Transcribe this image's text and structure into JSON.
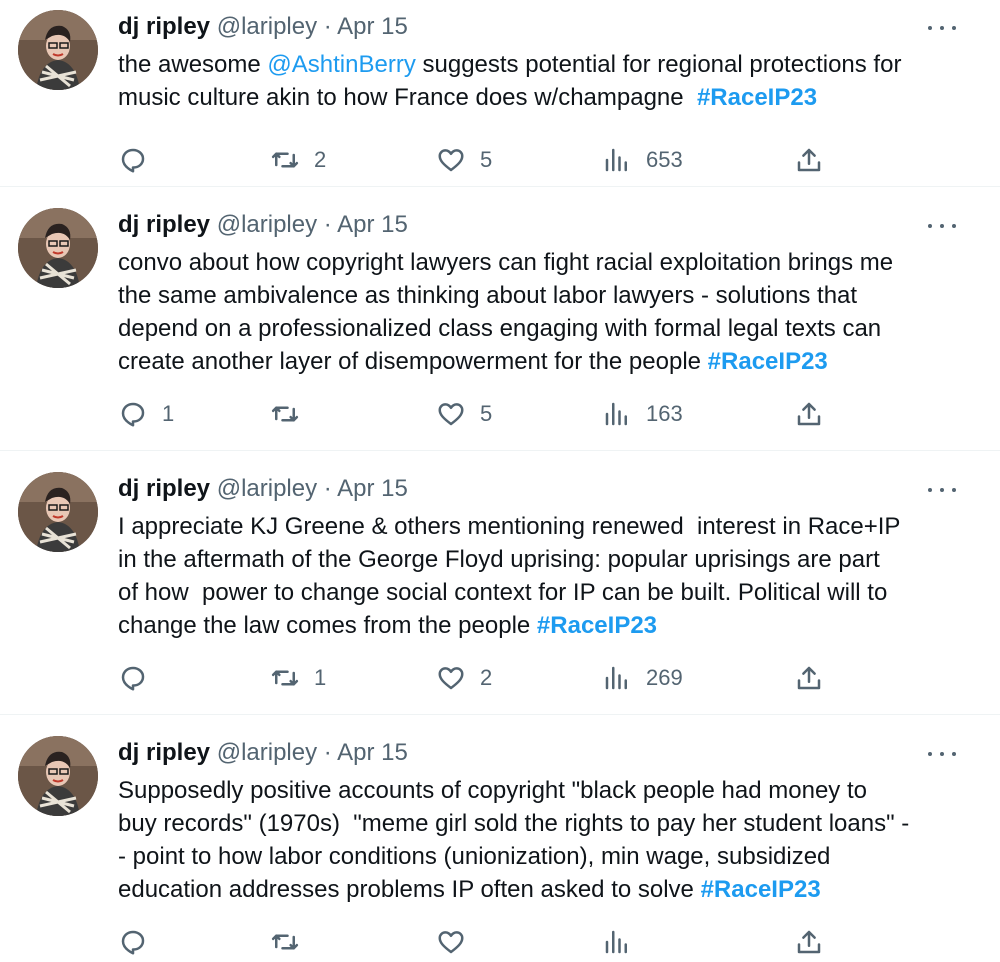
{
  "tweets": [
    {
      "name": "dj ripley",
      "handle": "@laripley",
      "dot": "·",
      "date": "Apr 15",
      "segments": [
        {
          "t": "text",
          "v": "the awesome "
        },
        {
          "t": "link",
          "v": "@AshtinBerry"
        },
        {
          "t": "text",
          "v": " suggests potential for regional protections for\nmusic culture akin to how France does w/champagne  "
        },
        {
          "t": "hashtag",
          "v": "#RaceIP23"
        }
      ],
      "replies": "",
      "retweets": "2",
      "likes": "5",
      "views": "653"
    },
    {
      "name": "dj ripley",
      "handle": "@laripley",
      "dot": "·",
      "date": "Apr 15",
      "segments": [
        {
          "t": "text",
          "v": "convo about how copyright lawyers can fight racial exploitation brings me\nthe same ambivalence as thinking about labor lawyers - solutions that\ndepend on a professionalized class engaging with formal legal texts can\ncreate another layer of disempowerment for the people "
        },
        {
          "t": "hashtag",
          "v": "#RaceIP23"
        }
      ],
      "replies": "1",
      "retweets": "",
      "likes": "5",
      "views": "163"
    },
    {
      "name": "dj ripley",
      "handle": "@laripley",
      "dot": "·",
      "date": "Apr 15",
      "segments": [
        {
          "t": "text",
          "v": "I appreciate KJ Greene & others mentioning renewed  interest in Race+IP\nin the aftermath of the George Floyd uprising: popular uprisings are part\nof how  power to change social context for IP can be built. Political will to\nchange the law comes from the people "
        },
        {
          "t": "hashtag",
          "v": "#RaceIP23"
        }
      ],
      "replies": "",
      "retweets": "1",
      "likes": "2",
      "views": "269"
    },
    {
      "name": "dj ripley",
      "handle": "@laripley",
      "dot": "·",
      "date": "Apr 15",
      "segments": [
        {
          "t": "text",
          "v": "Supposedly positive accounts of copyright \"black people had money to\nbuy records\" (1970s)  \"meme girl sold the rights to pay her student loans\" -\n- point to how labor conditions (unionization), min wage, subsidized\neducation addresses problems IP often asked to solve "
        },
        {
          "t": "hashtag",
          "v": "#RaceIP23"
        }
      ],
      "replies": "",
      "retweets": "",
      "likes": "",
      "views": ""
    }
  ],
  "icons": {
    "reply": "reply-icon",
    "retweet": "retweet-icon",
    "like": "heart-icon",
    "views": "views-icon",
    "share": "share-icon",
    "more": "more-icon"
  },
  "colors": {
    "link": "#1d9bf0",
    "secondary_text": "#536471",
    "divider": "#eff3f4"
  }
}
